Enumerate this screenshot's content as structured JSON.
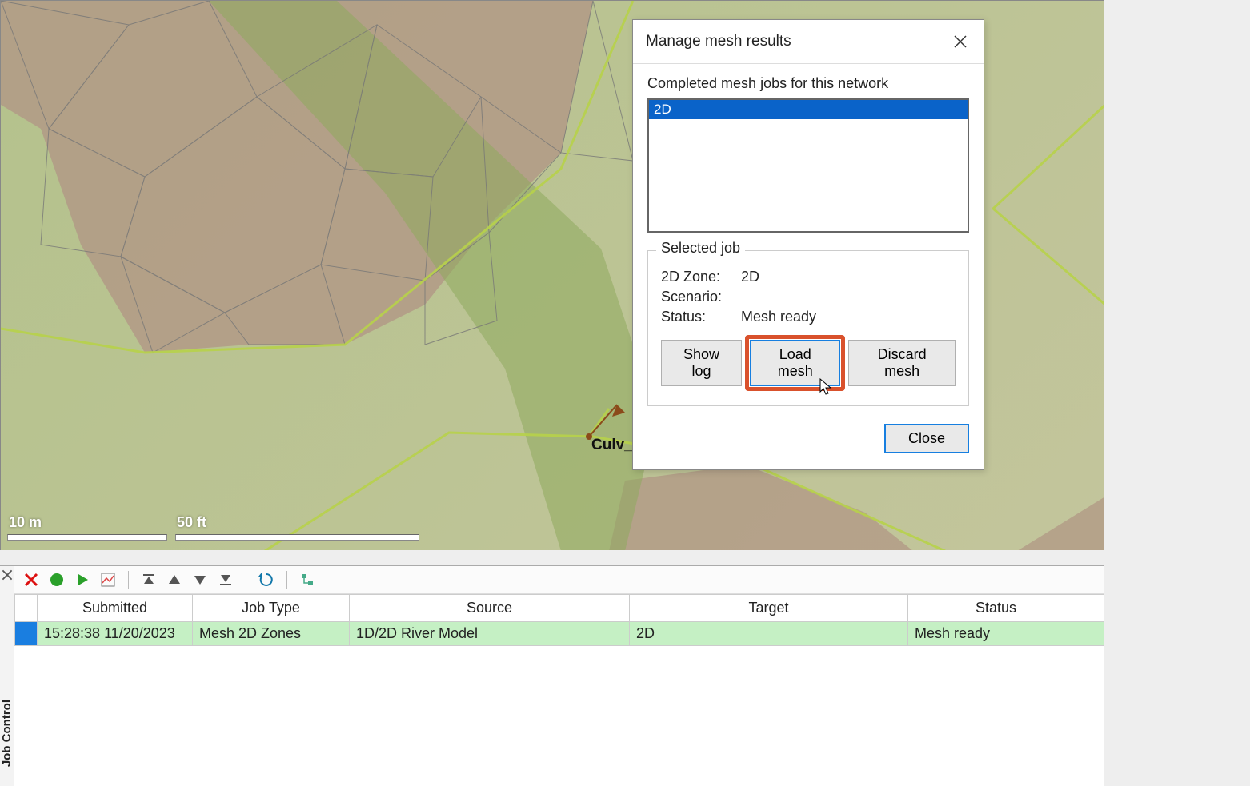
{
  "map": {
    "scale1_label": "10 m",
    "scale2_label": "50 ft",
    "node_label": "Culv_"
  },
  "dialog": {
    "title": "Manage mesh results",
    "list_label": "Completed mesh jobs for this network",
    "list_item": "2D",
    "group_legend": "Selected job",
    "zone_key": "2D Zone:",
    "zone_val": "2D",
    "scenario_key": "Scenario:",
    "scenario_val": "",
    "status_key": "Status:",
    "status_val": "Mesh ready",
    "btn_showlog": "Show log",
    "btn_load": "Load mesh",
    "btn_discard": "Discard mesh",
    "btn_close": "Close"
  },
  "panel": {
    "tab_label": "Job Control",
    "columns": {
      "submitted": "Submitted",
      "jobtype": "Job Type",
      "source": "Source",
      "target": "Target",
      "status": "Status"
    },
    "row": {
      "submitted": "15:28:38 11/20/2023",
      "jobtype": "Mesh 2D Zones",
      "source": "1D/2D River Model",
      "target": "2D",
      "status": "Mesh ready"
    }
  }
}
